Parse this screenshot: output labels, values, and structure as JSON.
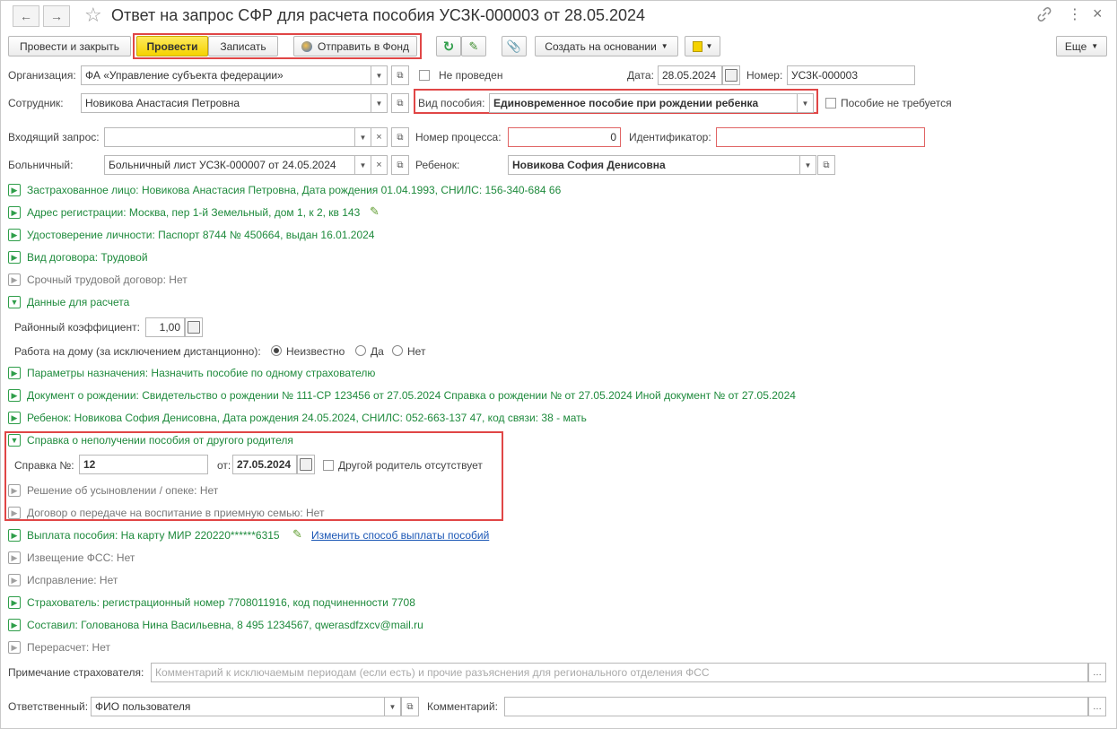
{
  "window": {
    "title": "Ответ на запрос СФР для расчета пособия УСЗК-000003 от 28.05.2024",
    "nav_back": "←",
    "nav_forward": "→",
    "star": "☆",
    "link_icon": "🔗",
    "menu_icon": "⋮",
    "close_icon": "×"
  },
  "toolbar": {
    "post_close": "Провести и закрыть",
    "post": "Провести",
    "save": "Записать",
    "send": "Отправить в Фонд",
    "create_based": "Создать на основании",
    "more": "Еще"
  },
  "form": {
    "org_label": "Организация:",
    "org_value": "ФА «Управление субъекта федерации»",
    "not_posted_label": "Не проведен",
    "date_label": "Дата:",
    "date_value": "28.05.2024",
    "number_label": "Номер:",
    "number_value": "УС3К-000003",
    "employee_label": "Сотрудник:",
    "employee_value": "Новикова Анастасия Петровна",
    "benefit_kind_label": "Вид пособия:",
    "benefit_kind_value": "Единовременное пособие при рождении ребенка",
    "benefit_not_required": "Пособие не требуется",
    "incoming_label": "Входящий запрос:",
    "incoming_value": "",
    "process_label": "Номер процесса:",
    "process_value": "0",
    "identifier_label": "Идентификатор:",
    "identifier_value": "",
    "sick_label": "Больничный:",
    "sick_value": "Больничный лист УС3К-000007 от 24.05.2024",
    "child_label": "Ребенок:",
    "child_value": "Новикова София Денисовна"
  },
  "groups": {
    "insured": "Застрахованное лицо: Новикова Анастасия Петровна, Дата рождения 01.04.1993, СНИЛС: 156-340-684 66",
    "address": "Адрес регистрации: Москва, пер 1-й Земельный, дом 1, к 2, кв 143",
    "id_doc": "Удостоверение личности: Паспорт 8744 № 450664, выдан 16.01.2024",
    "contract": "Вид договора: Трудовой",
    "fixed_term": "Срочный трудовой договор: Нет",
    "calc_data": "Данные для расчета",
    "params": "Параметры назначения: Назначить пособие по одному страхователю",
    "birth_doc": "Документ о рождении: Свидетельство о рождении № 111-СР 123456 от 27.05.2024 Справка о рождении №  от 27.05.2024 Иной документ №  от 27.05.2024",
    "child": "Ребенок: Новикова София Денисовна, Дата рождения 24.05.2024, СНИЛС: 052-663-137 47, код связи: 38 - мать",
    "cert_other_parent": "Справка о неполучении пособия от другого родителя",
    "adoption": "Решение об усыновлении / опеке: Нет",
    "foster": "Договор о передаче на воспитание в приемную семью: Нет",
    "payment": "Выплата пособия: На карту МИР 220220******6315",
    "payment_link": "Изменить способ выплаты пособий",
    "fss_notice": "Извещение ФСС: Нет",
    "correction": "Исправление: Нет",
    "insurer": "Страхователь: регистрационный номер 7708011916, код подчиненности 7708",
    "author": "Составил: Голованова Нина Васильевна, 8 495 1234567, qwerasdfzxcv@mail.ru",
    "recalc": "Перерасчет: Нет"
  },
  "calc": {
    "district_label": "Районный коэффициент:",
    "district_value": "1,00",
    "home_work_label": "Работа на дому (за исключением дистанционно):",
    "opt_unknown": "Неизвестно",
    "opt_yes": "Да",
    "opt_no": "Нет",
    "selected": "Неизвестно"
  },
  "cert": {
    "number_label": "Справка №:",
    "number_value": "12",
    "date_label": "от:",
    "date_value": "27.05.2024",
    "absent_label": "Другой родитель отсутствует"
  },
  "footer": {
    "note_label": "Примечание страхователя:",
    "note_placeholder": "Комментарий к исключаемым периодам (если есть) и прочие разъяснения для регионального отделения ФСС",
    "responsible_label": "Ответственный:",
    "responsible_value": "ФИО пользователя",
    "comment_label": "Комментарий:",
    "comment_value": ""
  },
  "colors": {
    "accent_yellow": "#f5d200",
    "group_green": "#1e8a3c",
    "highlight_red": "#e04646",
    "link_blue": "#1a56b5"
  }
}
